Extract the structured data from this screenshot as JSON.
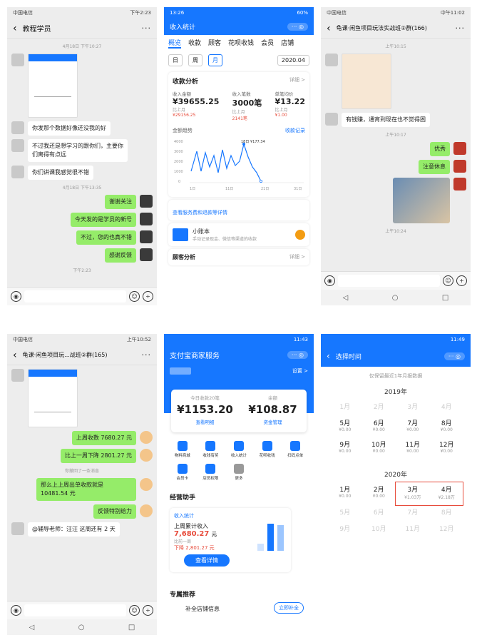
{
  "p1": {
    "status_left": "中国电信",
    "status_right": "下午2:23",
    "title": "教程学员",
    "time1": "4月18日 下午10:27",
    "msgs_left": [
      "你发那个数据好像还没我的好",
      "不过我还是想学习的跟你们，主要你们离得有点远",
      "你们讲课我感觉很不错"
    ],
    "time2": "4月18日 下午13:35",
    "msgs_right": [
      "谢谢关注",
      "今天发的是学员的新号",
      "不过，您的也真不错",
      "感谢反馈"
    ],
    "time3": "下午2:23"
  },
  "p2": {
    "status_left": "13:26",
    "status_right": "60%",
    "header": "收入统计",
    "tabs": [
      "概览",
      "收款",
      "顾客",
      "花呗收钱",
      "会员",
      "店铺"
    ],
    "ranges": [
      "日",
      "周",
      "月"
    ],
    "date": "2020.04",
    "card_title": "收款分析",
    "detail": "详细 >",
    "stats": [
      {
        "label": "收入金额",
        "value": "¥39655.25",
        "cmp_label": "比上月",
        "cmp": "¥29156.25"
      },
      {
        "label": "收入笔数",
        "value": "3000笔",
        "cmp_label": "比上月",
        "cmp": "2141笔"
      },
      {
        "label": "单笔均价",
        "value": "¥13.22",
        "cmp_label": "比上月",
        "cmp": "¥1.00"
      }
    ],
    "trend_label": "金额趋势",
    "record_link": "收款记录",
    "peak_label": "18日 ¥177.34",
    "y_ticks": [
      "4000",
      "3000",
      "2000",
      "1000",
      "0"
    ],
    "x_ticks": [
      "1日",
      "11日",
      "21日",
      "31日"
    ],
    "fee_link": "查看服务费和退款等详情",
    "ledger_title": "小账本",
    "ledger_desc": "手动记录现金、微信等渠道的收款",
    "customer_title": "顾客分析",
    "customer_detail": "详细 >"
  },
  "p3": {
    "status_left": "中国电信",
    "status_right": "中午11:02",
    "title": "龟课·闲鱼项目玩法实战班②群(166)",
    "time1": "上午10:15",
    "msg_left": "有钱赚，通宵到现在也不觉得困",
    "time2": "上午10:17",
    "msgs_right": [
      "优秀",
      "注意休息"
    ],
    "time3": "上午10:24"
  },
  "p4": {
    "status_left": "中国电信",
    "status_right": "上午10:52",
    "title": "龟课·闲鱼项目玩...战班②群(165)",
    "msgs_right": [
      "上周收数 7680.27 元",
      "比上一周下降 2801.27 元",
      "那么上上周出单收款就是 10481.54 元",
      "反馈特别给力"
    ],
    "recall": "你撤回了一条消息",
    "msg_left": "@辅导老师：汪汪  这周还有 2 天"
  },
  "p5": {
    "status_right": "11:43",
    "header": "支付宝商家服务",
    "settings": "设置 >",
    "today_label": "今日收款20笔",
    "today_value": "¥1153.20",
    "today_link": "查看明细",
    "balance_label": "余额",
    "balance_value": "¥108.87",
    "balance_link": "资金管理",
    "icons": [
      "物料商城",
      "收钱有奖",
      "收入统计",
      "花呗收钱",
      "扫码点单",
      "会员卡",
      "店员权限",
      "更多"
    ],
    "assistant": "经营助手",
    "income_stat": "收入统计",
    "week_label": "上周累计收入",
    "week_value": "7,680.27",
    "week_unit": "元",
    "compare_label": "比前一周",
    "compare_value": "下降 2,801.27 元",
    "bar_labels": [
      "6笔",
      "151笔",
      "150笔"
    ],
    "detail_button": "查看详情",
    "recommend": "专属推荐",
    "store_info": "补全店铺信息",
    "fill_button": "立即补全"
  },
  "p6": {
    "status_right": "11:49",
    "header": "选择时间",
    "notice": "仅保留最近1年月报数据",
    "year1": "2019年",
    "months_2019_dim": [
      "1月",
      "2月",
      "3月",
      "4月"
    ],
    "months_2019": [
      {
        "m": "5月",
        "a": "¥0.00"
      },
      {
        "m": "6月",
        "a": "¥0.00"
      },
      {
        "m": "7月",
        "a": "¥0.00"
      },
      {
        "m": "8月",
        "a": "¥0.00"
      },
      {
        "m": "9月",
        "a": "¥0.00"
      },
      {
        "m": "10月",
        "a": "¥0.00"
      },
      {
        "m": "11月",
        "a": "¥0.00"
      },
      {
        "m": "12月",
        "a": "¥0.00"
      }
    ],
    "year2": "2020年",
    "months_2020": [
      {
        "m": "1月",
        "a": "¥0.00"
      },
      {
        "m": "2月",
        "a": "¥0.00"
      },
      {
        "m": "3月",
        "a": "¥1.03万"
      },
      {
        "m": "4月",
        "a": "¥2.18万"
      }
    ],
    "months_2020_dim": [
      "5月",
      "6月",
      "7月",
      "8月",
      "9月",
      "10月",
      "11月",
      "12月"
    ]
  },
  "colors": {
    "wechat_green": "#95ec69",
    "alipay_blue": "#1677ff",
    "highlight_red": "#e74c3c"
  }
}
